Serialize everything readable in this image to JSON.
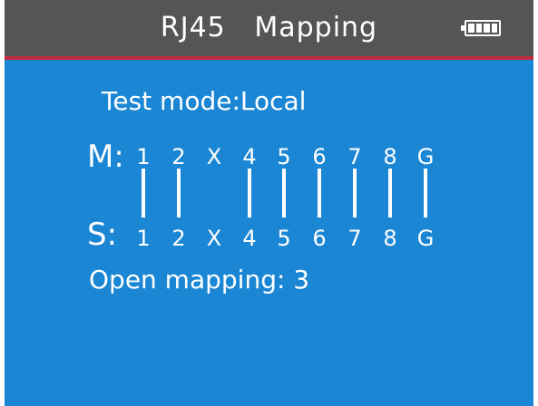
{
  "header": {
    "title": "RJ45   Mapping",
    "battery_icon": "battery-full-icon",
    "background_color": "#555555",
    "divider_color": "#c22a3c"
  },
  "screen": {
    "background_color": "#1a86d4",
    "test_mode": "Test mode:Local",
    "master_label": "M:",
    "slave_label": "S:",
    "master_pins": [
      "1",
      "2",
      "X",
      "4",
      "5",
      "6",
      "7",
      "8",
      "G"
    ],
    "slave_pins": [
      "1",
      "2",
      "X",
      "4",
      "5",
      "6",
      "7",
      "8",
      "G"
    ],
    "connected": [
      true,
      true,
      false,
      true,
      true,
      true,
      true,
      true,
      true
    ],
    "open_mapping": "Open mapping: 3"
  }
}
